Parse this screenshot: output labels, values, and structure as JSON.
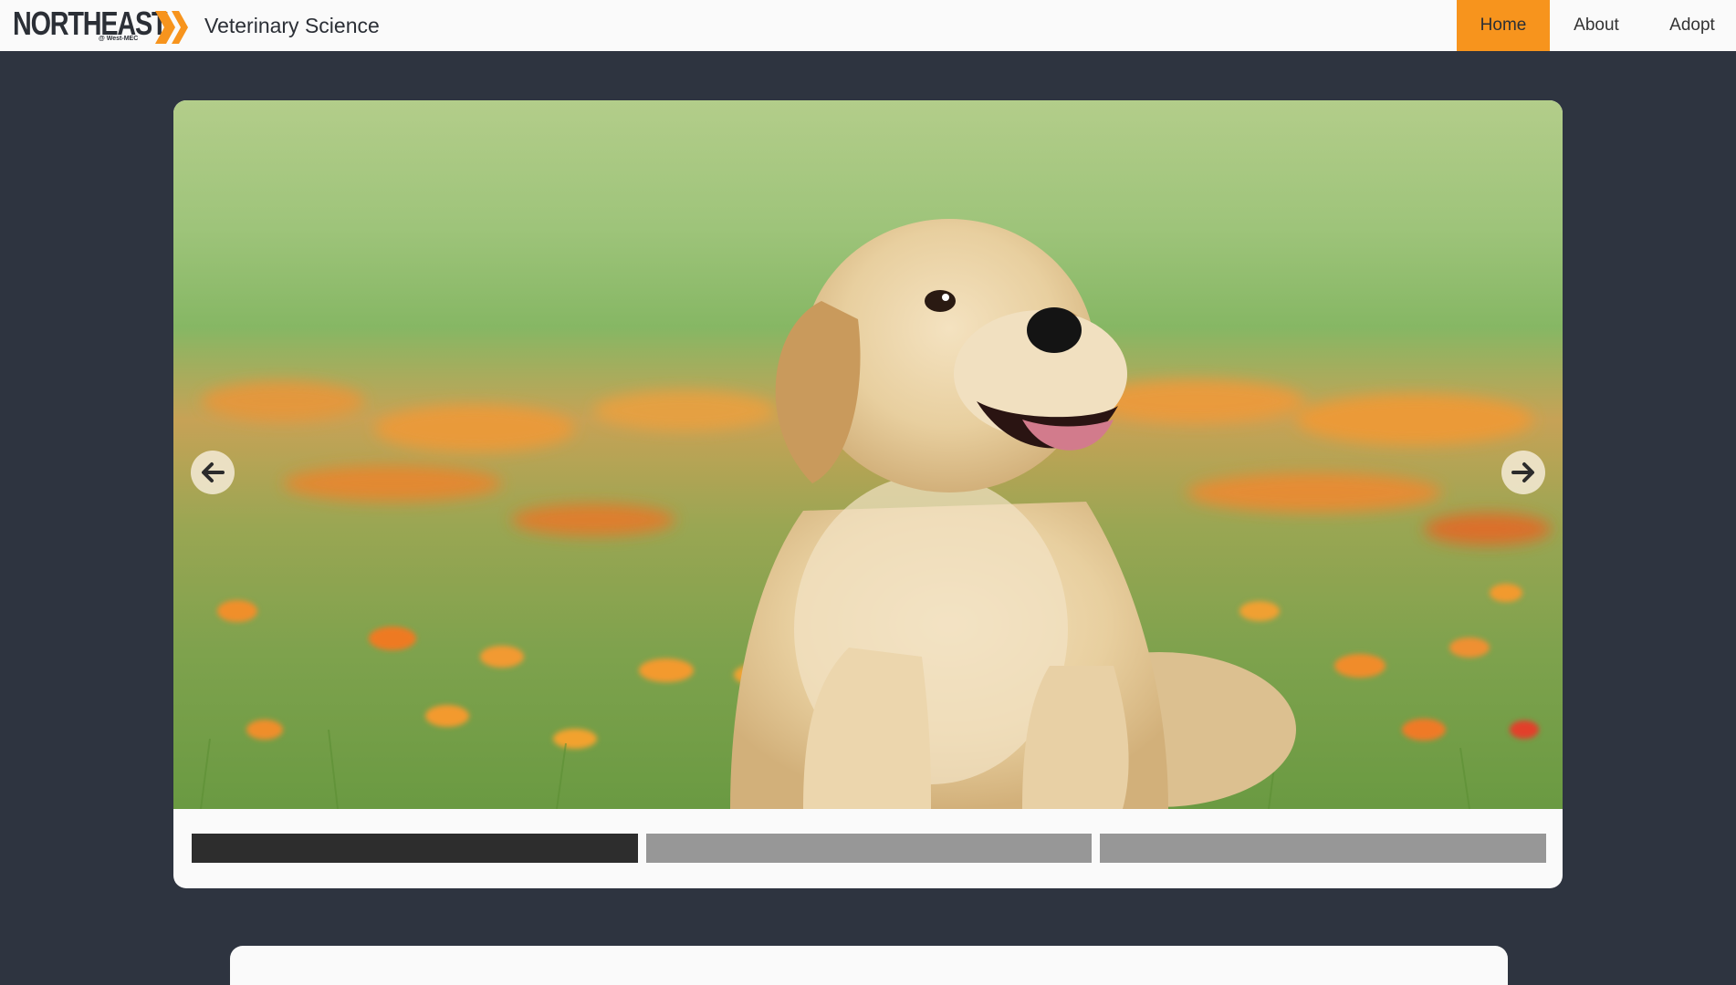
{
  "header": {
    "logo": {
      "word": "NORTHEAST",
      "sub": "@ West-MEC"
    },
    "site_title": "Veterinary Science",
    "nav": [
      {
        "label": "Home",
        "active": true
      },
      {
        "label": "About",
        "active": false
      },
      {
        "label": "Adopt",
        "active": false
      }
    ]
  },
  "carousel": {
    "slide_count": 3,
    "current_slide": 1,
    "slide_image": "golden-retriever-puppy-in-flower-meadow",
    "prev_icon": "arrow-left-icon",
    "next_icon": "arrow-right-icon"
  },
  "colors": {
    "page_background": "#2e3440",
    "header_background": "#fafafa",
    "accent": "#f7941d",
    "indicator_active": "#2d2d2d",
    "indicator_inactive": "#979797"
  }
}
